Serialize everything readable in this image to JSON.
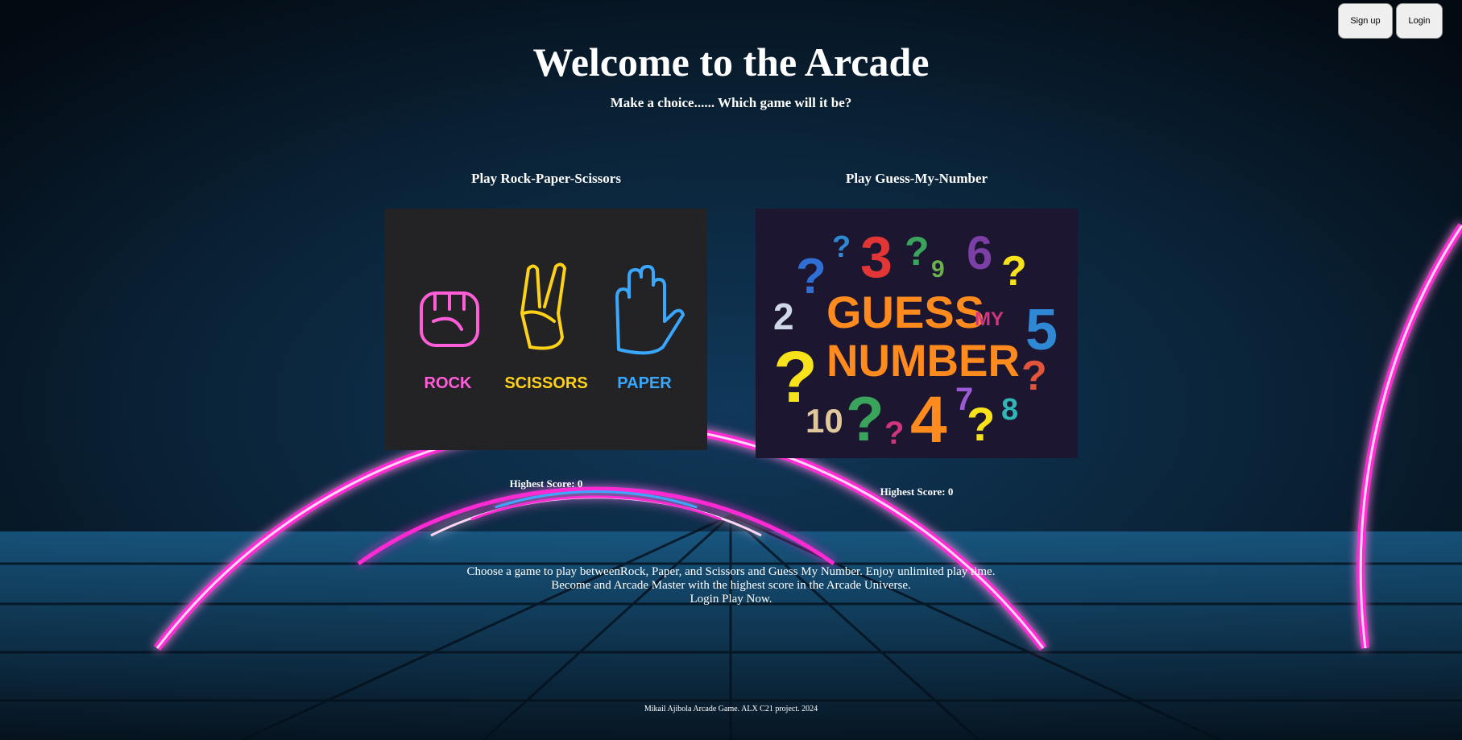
{
  "auth": {
    "signup_label": "Sign up",
    "login_label": "Login"
  },
  "header": {
    "title": "Welcome to the Arcade",
    "subtitle": "Make a choice...... Which game will it be?"
  },
  "games": [
    {
      "title": "Play Rock-Paper-Scissors",
      "image_labels": [
        "ROCK",
        "SCISSORS",
        "PAPER"
      ],
      "score_text": "Highest Score: 0"
    },
    {
      "title": "Play Guess-My-Number",
      "image_labels": [
        "GUESS",
        "MY",
        "NUMBER"
      ],
      "score_text": "Highest Score: 0"
    }
  ],
  "description": [
    "Choose a game to play betweenRock, Paper, and Scissors and Guess My Number. Enjoy unlimited play time.",
    "Become and Arcade Master with the highest score in the Arcade Universe.",
    "Login Play Now."
  ],
  "footer": {
    "text": "Mikail Ajibola Arcade Game. ALX C21 project. 2024"
  },
  "colors": {
    "neon_pink": "#ff2ad4",
    "neon_blue": "#3aa7ff",
    "neon_yellow": "#ffd21a",
    "background": "#071422"
  }
}
